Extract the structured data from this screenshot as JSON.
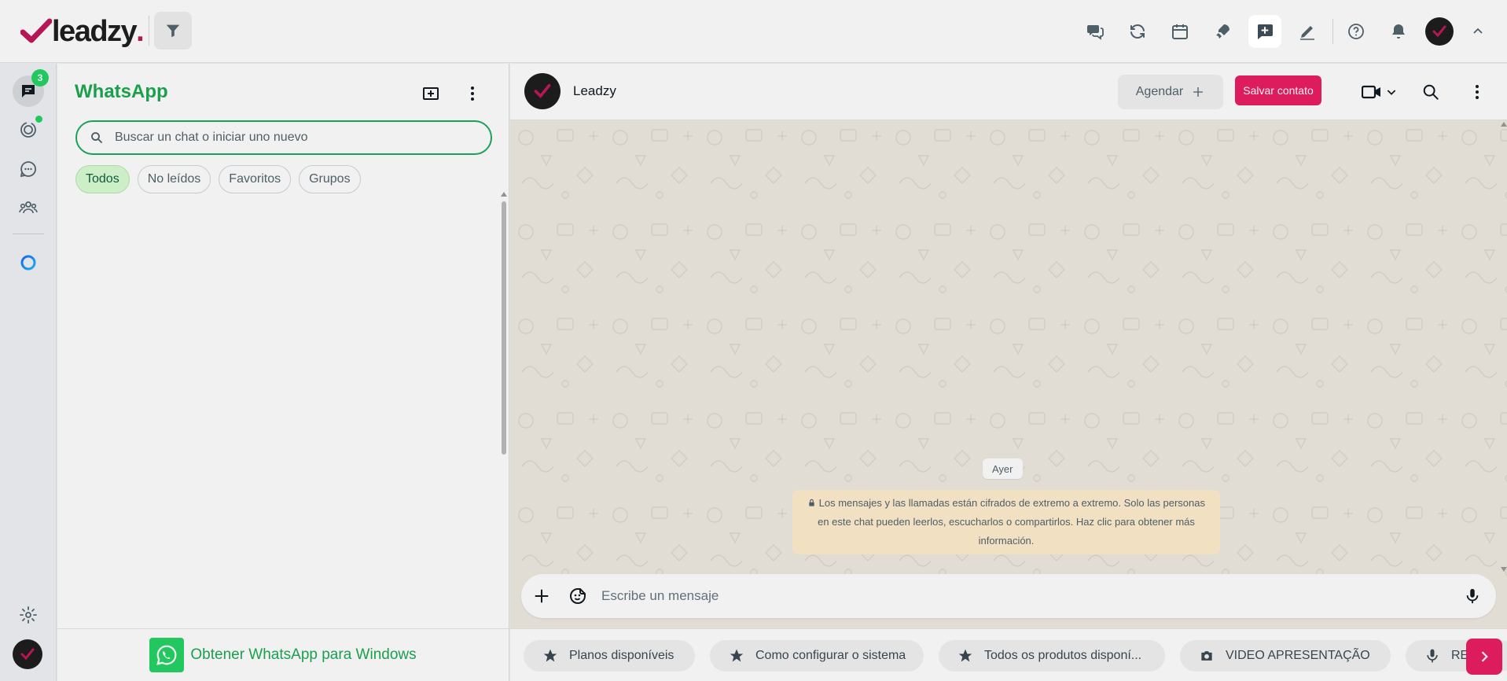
{
  "app": {
    "logo_text": "leadzy",
    "logo_dot": "."
  },
  "topbar": {
    "icons": [
      "chat-bubbles-icon",
      "refresh-icon",
      "calendar-icon",
      "rocket-icon",
      "message-add-icon",
      "pen-icon",
      "help-icon",
      "bell-icon"
    ],
    "active_icon": "message-add-icon"
  },
  "rail": {
    "unread_count": "3"
  },
  "chatlist": {
    "title": "WhatsApp",
    "search_placeholder": "Buscar un chat o iniciar uno nuevo",
    "filters": [
      "Todos",
      "No leídos",
      "Favoritos",
      "Grupos"
    ],
    "active_filter": "Todos",
    "footer_text": "Obtener WhatsApp para Windows"
  },
  "conversation": {
    "contact_name": "Leadzy",
    "agendar_label": "Agendar",
    "salvar_label": "Salvar contato",
    "date_label": "Ayer",
    "encryption_notice": "Los mensajes y las llamadas están cifrados de extremo a extremo. Solo las personas en este chat pueden leerlos, escucharlos o compartirlos. Haz clic para obtener más información.",
    "composer_placeholder": "Escribe un mensaje"
  },
  "quick_replies": [
    {
      "icon": "star-icon",
      "label": "Planos disponíveis"
    },
    {
      "icon": "star-icon",
      "label": "Como configurar o sistema"
    },
    {
      "icon": "star-icon",
      "label": "Todos os produtos disponí..."
    },
    {
      "icon": "camera-icon",
      "label": "VIDEO APRESENTAÇÃO"
    },
    {
      "icon": "mic-icon",
      "label": "RE"
    }
  ],
  "colors": {
    "whatsapp_green": "#1ea952",
    "accent_pink": "#e91e63",
    "notice_bg": "#ffeecd",
    "chat_bg": "#efeae2"
  }
}
